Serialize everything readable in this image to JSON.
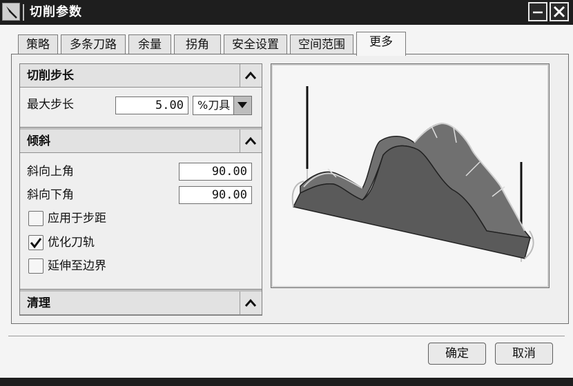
{
  "window": {
    "title": "切削参数"
  },
  "tabs": [
    {
      "label": "策略"
    },
    {
      "label": "多条刀路"
    },
    {
      "label": "余量"
    },
    {
      "label": "拐角"
    },
    {
      "label": "安全设置"
    },
    {
      "label": "空间范围"
    },
    {
      "label": "更多",
      "active": true
    }
  ],
  "sections": {
    "step": {
      "title": "切削步长",
      "max_step_label": "最大步长",
      "max_step_value": "5.00",
      "unit_value": "%刀具"
    },
    "slope": {
      "title": "倾斜",
      "up_label": "斜向上角",
      "up_value": "90.00",
      "down_label": "斜向下角",
      "down_value": "90.00",
      "apply_label": "应用于步距",
      "apply_checked": false,
      "optimize_label": "优化刀轨",
      "optimize_checked": true,
      "extend_label": "延伸至边界",
      "extend_checked": false
    },
    "cleanup": {
      "title": "清理"
    }
  },
  "buttons": {
    "ok": "确定",
    "cancel": "取消"
  },
  "icons": {
    "collapse": "chevron-up-icon",
    "dropdown": "triangle-down-icon",
    "check": "checkmark-icon",
    "minimize": "minimize-icon",
    "close": "close-icon",
    "app": "tool-icon"
  }
}
